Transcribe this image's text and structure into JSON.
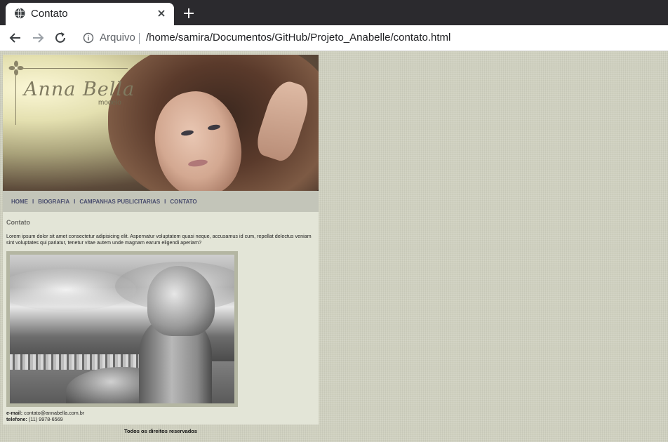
{
  "browser": {
    "tab_title": "Contato",
    "address_scheme": "Arquivo",
    "address_url": "/home/samira/Documentos/GitHub/Projeto_Anabelle/contato.html"
  },
  "site": {
    "brand_name": "Anna Bella",
    "brand_sub": "modelo",
    "nav": [
      "HOME",
      "BIOGRAFIA",
      "CAMPANHAS PUBLICITARIAS",
      "CONTATO"
    ],
    "nav_separator": "I",
    "heading": "Contato",
    "lorem": "Lorem ipsum dolor sit amet consectetur adipisicing elit. Aspernatur voluptatem quasi neque, accusamus id cum, repellat delectus veniam sint voluptates qui pariatur, tenetur vitae autem unde magnam earum eligendi aperiam?",
    "email_label": "e-mail:",
    "email_value": "contato@annabella.com.br",
    "phone_label": "telefone:",
    "phone_value": "(11) 9978-6569",
    "footer": "Todos os direitos reservados"
  },
  "icons": {
    "tab_favicon": "globe-icon",
    "tab_close": "close-icon",
    "new_tab": "plus-icon",
    "back": "arrow-left-icon",
    "forward": "arrow-right-icon",
    "reload": "reload-icon",
    "site_info": "info-icon",
    "brand_ornament": "flower-icon"
  },
  "colors": {
    "page_bg": "#cfd0bf",
    "content_bg": "#e3e5d7",
    "nav_bg": "#c3c5b9",
    "nav_text": "#4a4e6e",
    "browser_dark": "#2b2a2e"
  }
}
